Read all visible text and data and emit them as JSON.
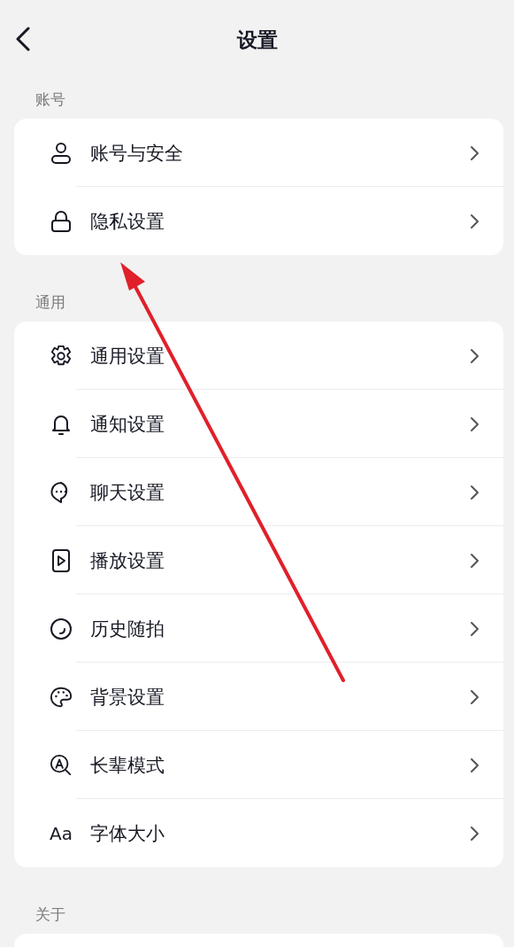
{
  "header": {
    "title": "设置"
  },
  "sections": [
    {
      "title": "账号",
      "items": [
        {
          "label": "账号与安全"
        },
        {
          "label": "隐私设置"
        }
      ]
    },
    {
      "title": "通用",
      "items": [
        {
          "label": "通用设置"
        },
        {
          "label": "通知设置"
        },
        {
          "label": "聊天设置"
        },
        {
          "label": "播放设置"
        },
        {
          "label": "历史随拍"
        },
        {
          "label": "背景设置"
        },
        {
          "label": "长辈模式"
        },
        {
          "label": "字体大小",
          "icon_text": "Aa"
        }
      ]
    },
    {
      "title": "关于"
    }
  ]
}
